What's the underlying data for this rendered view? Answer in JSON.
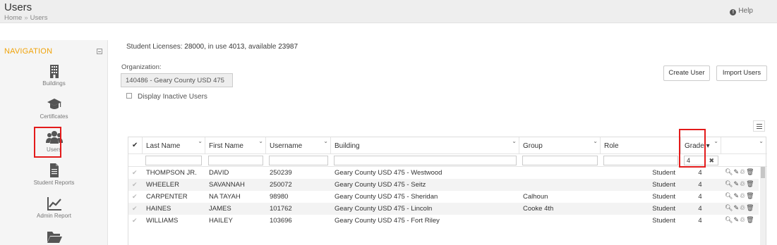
{
  "header": {
    "title": "Users",
    "breadcrumb": [
      "Home",
      "Users"
    ],
    "breadcrumb_sep": "»",
    "help_label": "Help"
  },
  "sidebar": {
    "title": "NAVIGATION",
    "items": [
      {
        "label": "Buildings",
        "icon": "building-icon"
      },
      {
        "label": "Certificates",
        "icon": "graduation-cap-icon"
      },
      {
        "label": "Users",
        "icon": "users-icon",
        "active": true
      },
      {
        "label": "Student Reports",
        "icon": "file-icon"
      },
      {
        "label": "Admin Report",
        "icon": "line-chart-icon"
      },
      {
        "label": "",
        "icon": "folder-icon"
      }
    ]
  },
  "licenses": {
    "prefix": "Student Licenses:",
    "total": "28000",
    "in_use_label": "in use",
    "in_use": "4013",
    "available_label": "available",
    "available": "23987"
  },
  "organization": {
    "label": "Organization:",
    "value": "140486 - Geary County USD 475"
  },
  "inactive_label": "Display Inactive Users",
  "buttons": {
    "create": "Create User",
    "import": "Import Users"
  },
  "table": {
    "columns": [
      "Last Name",
      "First Name",
      "Username",
      "Building",
      "Group",
      "Role",
      "Grade"
    ],
    "grade_sort": "▾",
    "grade_filter": "4",
    "filter_clear": "✖",
    "rows": [
      {
        "last": "THOMPSON JR.",
        "first": "DAVID",
        "username": "250239",
        "building": "Geary County USD 475 - Westwood",
        "group": "",
        "role": "Student",
        "grade": "4"
      },
      {
        "last": "WHEELER",
        "first": "SAVANNAH",
        "username": "250072",
        "building": "Geary County USD 475 - Seitz",
        "group": "",
        "role": "Student",
        "grade": "4"
      },
      {
        "last": "CARPENTER",
        "first": "NA TAYAH",
        "username": "98980",
        "building": "Geary County USD 475 - Sheridan",
        "group": "Calhoun",
        "role": "Student",
        "grade": "4"
      },
      {
        "last": "HAINES",
        "first": "JAMES",
        "username": "101762",
        "building": "Geary County USD 475 - Lincoln",
        "group": "Cooke 4th",
        "role": "Student",
        "grade": "4"
      },
      {
        "last": "WILLIAMS",
        "first": "HAILEY",
        "username": "103696",
        "building": "Geary County USD 475 - Fort Riley",
        "group": "",
        "role": "Student",
        "grade": "4"
      }
    ]
  },
  "colors": {
    "nav_title": "#f0a30a",
    "highlight": "#e31b1b",
    "topbar": "#eeeeee"
  }
}
